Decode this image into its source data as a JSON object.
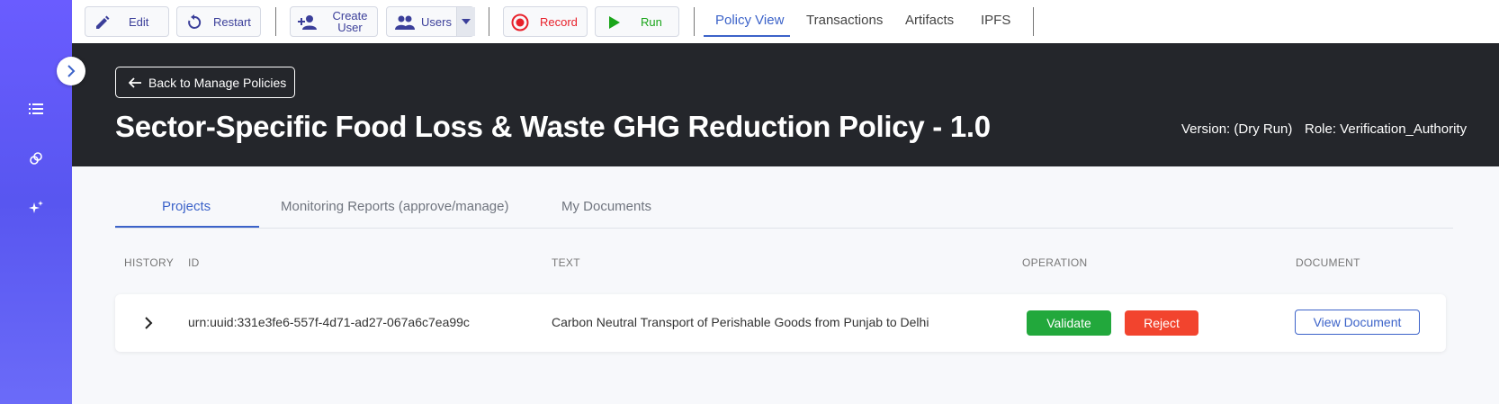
{
  "toolbar": {
    "edit_label": "Edit",
    "restart_label": "Restart",
    "create_user_label": "Create User",
    "users_label": "Users",
    "record_label": "Record",
    "run_label": "Run"
  },
  "policy_tabs": [
    "Policy View",
    "Transactions",
    "Artifacts",
    "IPFS"
  ],
  "active_policy_tab": "Policy View",
  "sidebar": {
    "icons": [
      "list-icon",
      "link-icon",
      "sparkle-icon"
    ]
  },
  "header": {
    "back_label": "Back to Manage Policies",
    "title": "Sector-Specific Food Loss & Waste GHG Reduction Policy - 1.0",
    "version": "Version: (Dry Run)",
    "role": "Role: Verification_Authority"
  },
  "tabs": [
    "Projects",
    "Monitoring Reports (approve/manage)",
    "My Documents"
  ],
  "active_tab": "Projects",
  "table": {
    "columns": [
      "HISTORY",
      "ID",
      "TEXT",
      "OPERATION",
      "DOCUMENT"
    ],
    "rows": [
      {
        "id": "urn:uuid:331e3fe6-557f-4d71-ad27-067a6c7ea99c",
        "text": "Carbon Neutral Transport of Perishable Goods from Punjab to Delhi",
        "validate_label": "Validate",
        "reject_label": "Reject",
        "document_label": "View Document"
      }
    ]
  },
  "colors": {
    "accent": "#3c63c9",
    "sidebar": "#5f5af5",
    "header_bg": "#24262b",
    "validate": "#22a83c",
    "reject": "#f2442e",
    "record": "#e8202a",
    "run": "#1aa51a"
  }
}
